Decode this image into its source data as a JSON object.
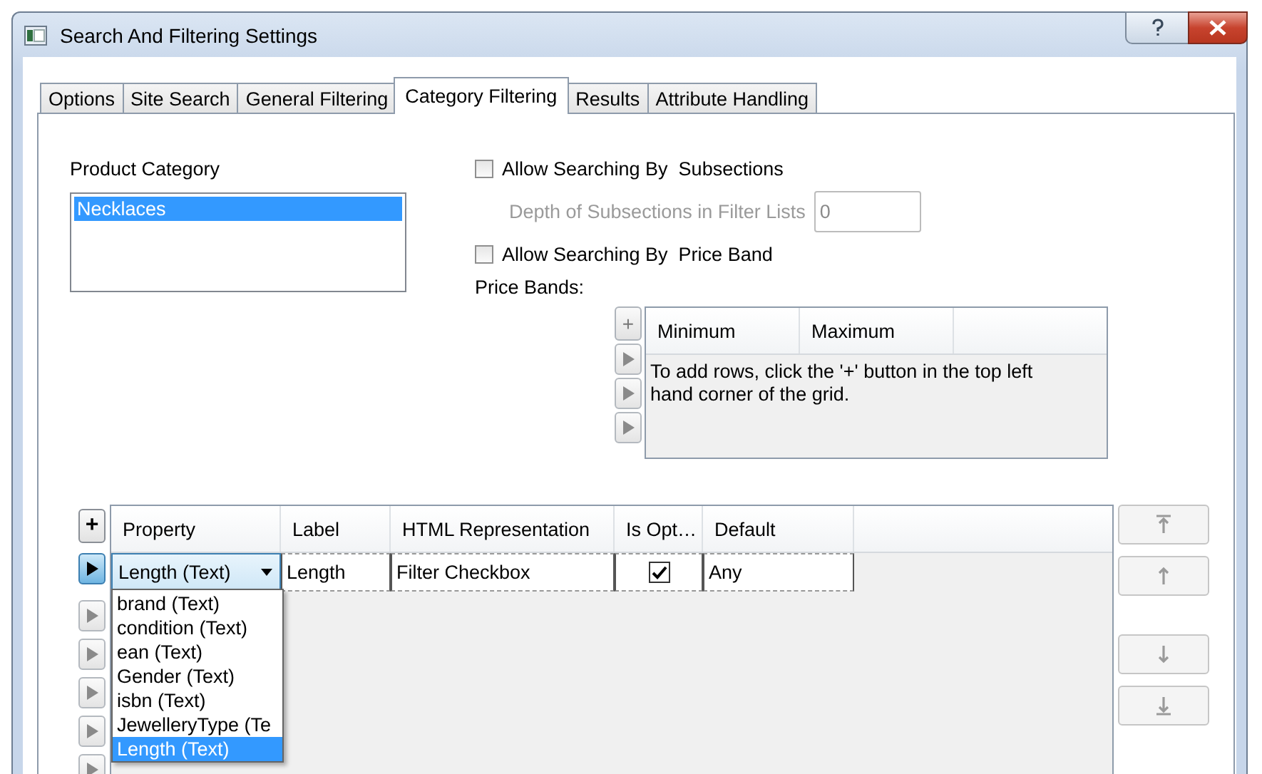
{
  "window": {
    "title": "Search And Filtering Settings"
  },
  "tabs": [
    {
      "label": "Options",
      "selected": false
    },
    {
      "label": "Site Search",
      "selected": false
    },
    {
      "label": "General Filtering",
      "selected": false
    },
    {
      "label": "Category Filtering",
      "selected": true
    },
    {
      "label": "Results",
      "selected": false
    },
    {
      "label": "Attribute Handling",
      "selected": false
    }
  ],
  "product_category": {
    "label": "Product Category",
    "items": [
      {
        "text": "Necklaces",
        "selected": true
      }
    ]
  },
  "allow_subsections": {
    "label": "Allow Searching By  Subsections",
    "checked": false
  },
  "depth": {
    "label": "Depth of Subsections in Filter Lists",
    "value": "0",
    "disabled": true
  },
  "allow_price_band": {
    "label": "Allow Searching By  Price Band",
    "checked": false
  },
  "price_bands": {
    "label": "Price Bands:",
    "add_button": "+",
    "columns": [
      "Minimum",
      "Maximum"
    ],
    "row_selectors": [
      {
        "selected": false
      },
      {
        "selected": false
      },
      {
        "selected": false
      }
    ],
    "empty_message": "To add rows, click the '+' button in the top left hand corner of the grid."
  },
  "property_grid": {
    "add_button": "+",
    "columns": [
      "Property",
      "Label",
      "HTML Representation",
      "Is Opt…",
      "Default"
    ],
    "rows": [
      {
        "property": "Length (Text)",
        "label": "Length",
        "html_representation": "Filter Checkbox",
        "is_optional": true,
        "default": "Any"
      }
    ],
    "row_selectors": [
      {
        "selected": true
      },
      {
        "selected": false
      },
      {
        "selected": false
      },
      {
        "selected": false
      },
      {
        "selected": false
      },
      {
        "selected": false
      }
    ],
    "dropdown": {
      "items": [
        {
          "text": "brand (Text)",
          "selected": false
        },
        {
          "text": "condition (Text)",
          "selected": false
        },
        {
          "text": "ean (Text)",
          "selected": false
        },
        {
          "text": "Gender (Text)",
          "selected": false
        },
        {
          "text": "isbn (Text)",
          "selected": false
        },
        {
          "text": "JewelleryType (Te",
          "selected": false
        },
        {
          "text": "Length (Text)",
          "selected": true
        }
      ]
    }
  },
  "move_buttons": [
    {
      "kind": "top",
      "disabled": true
    },
    {
      "kind": "up",
      "disabled": true
    },
    {
      "kind": "down",
      "disabled": true
    },
    {
      "kind": "bottom",
      "disabled": true
    }
  ]
}
